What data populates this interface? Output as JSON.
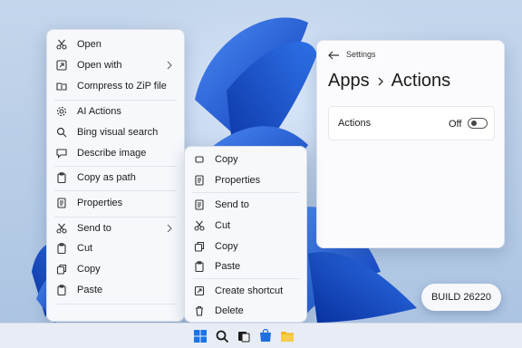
{
  "context_menu": {
    "items": [
      {
        "label": "Open",
        "icon": "scissors-icon"
      },
      {
        "label": "Open with",
        "icon": "open-with-icon",
        "submenu": true
      },
      {
        "label": "Compress to ZiP file",
        "icon": "zip-folder-icon"
      },
      {
        "label": "AI Actions",
        "icon": "gear-icon"
      },
      {
        "label": "Bing visual search",
        "icon": "search-icon"
      },
      {
        "label": "Describe image",
        "icon": "chat-icon"
      },
      {
        "label": "Copy as path",
        "icon": "clipboard-icon"
      },
      {
        "label": "Properties",
        "icon": "document-icon"
      },
      {
        "label": "Send to",
        "icon": "scissors-icon",
        "submenu": true
      },
      {
        "label": "Cut",
        "icon": "clipboard-icon"
      },
      {
        "label": "Copy",
        "icon": "copy-icon"
      },
      {
        "label": "Paste",
        "icon": "clipboard-icon"
      }
    ]
  },
  "submenu": {
    "items": [
      {
        "label": "Copy",
        "icon": "copy-icon"
      },
      {
        "label": "Properties",
        "icon": "document-icon"
      },
      {
        "label": "Send to",
        "icon": "document-icon"
      },
      {
        "label": "Cut",
        "icon": "scissors-icon"
      },
      {
        "label": "Copy",
        "icon": "copy-icon"
      },
      {
        "label": "Paste",
        "icon": "clipboard-icon"
      },
      {
        "label": "Create shortcut",
        "icon": "shortcut-icon"
      },
      {
        "label": "Delete",
        "icon": "trash-icon"
      }
    ]
  },
  "settings": {
    "title": "Settings",
    "breadcrumb": {
      "parent": "Apps",
      "current": "Actions"
    },
    "actions_card": {
      "label": "Actions",
      "state": "Off",
      "toggle_on": false
    }
  },
  "badge": {
    "label": "BUILD 26220"
  },
  "taskbar": {
    "icons": [
      "windows-start-icon",
      "search-icon",
      "task-view-icon",
      "store-icon",
      "file-explorer-icon"
    ]
  },
  "colors": {
    "accent": "#0067c0",
    "wallpaper_blue": "#1e5fd8",
    "menu_background": "#f6f8fc"
  }
}
